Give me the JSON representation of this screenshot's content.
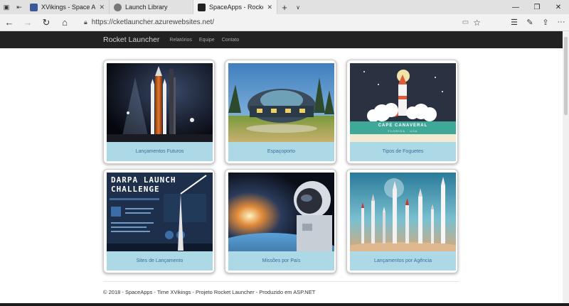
{
  "tabs": [
    {
      "title": "XVikings - Space Apps Chal",
      "active": false,
      "favicon_color": "#3b5998"
    },
    {
      "title": "Launch Library",
      "active": false,
      "favicon_color": "#777777"
    },
    {
      "title": "SpaceApps - Rocket Laur",
      "active": true,
      "favicon_color": "#222222"
    }
  ],
  "tabbar": {
    "new_tab_icon": "plus-icon",
    "dropdown_icon": "chevron-down-icon"
  },
  "address_bar": {
    "url": "https://cketlauncher.azurewebsites.net/"
  },
  "navbar": {
    "brand": "Rocket Launcher",
    "links": [
      "Relatórios",
      "Equipe",
      "Contato"
    ]
  },
  "cards": [
    {
      "caption": "Lançamentos Futuros",
      "image": "rocket-on-launch-pad-night"
    },
    {
      "caption": "Espaçoporto",
      "image": "futuristic-spaceport-building"
    },
    {
      "caption": "Tipos de Foguetes",
      "image": "cape-canaveral-illustration",
      "image_text": [
        "CAPE CANAVERAL",
        "FLORIDA · USA"
      ]
    },
    {
      "caption": "Sites de Lançamento",
      "image": "darpa-launch-challenge-infographic",
      "image_text": [
        "DARPA LAUNCH",
        "CHALLENGE"
      ]
    },
    {
      "caption": "Missões por País",
      "image": "astronaut-over-earth"
    },
    {
      "caption": "Lançamentos por Agência",
      "image": "rockets-lineup-comparison"
    }
  ],
  "footer": {
    "text": "© 2018 - SpaceApps - Time XVikings - Projeto Rocket Launcher - Produzido em ASP.NET"
  },
  "colors": {
    "navbar": "#222222",
    "caption_bg": "#add8e6",
    "caption_text": "#3a6f9a"
  }
}
